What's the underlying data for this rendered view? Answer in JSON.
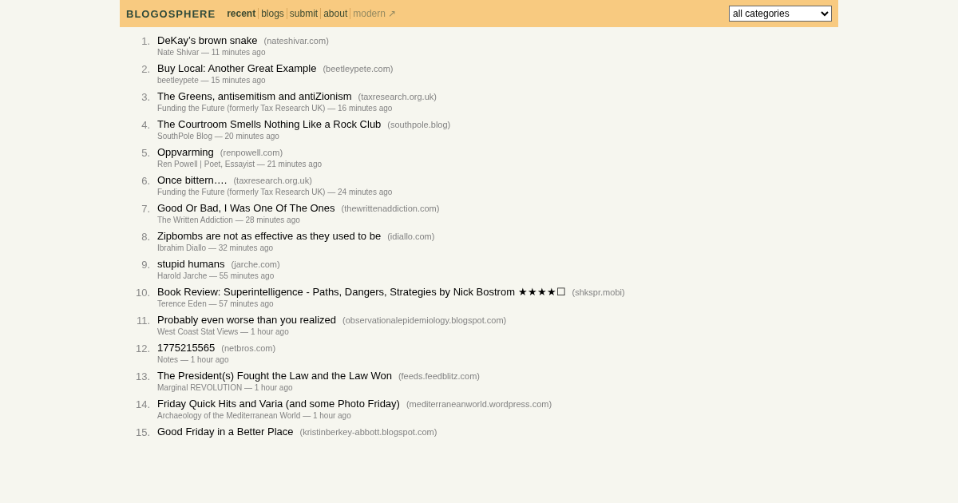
{
  "header": {
    "logo": "BLOGOSPHERE",
    "nav": [
      {
        "label": "recent",
        "selected": true,
        "kind": "internal"
      },
      {
        "label": "blogs",
        "selected": false,
        "kind": "internal"
      },
      {
        "label": "submit",
        "selected": false,
        "kind": "internal"
      },
      {
        "label": "about",
        "selected": false,
        "kind": "internal"
      },
      {
        "label": "modern ↗",
        "selected": false,
        "kind": "external"
      }
    ],
    "category_select": {
      "value": "all categories"
    }
  },
  "posts": [
    {
      "rank": "1.",
      "title": "DeKay’s brown snake",
      "domain": "(nateshivar.com)",
      "meta": "Nate Shivar — 11 minutes ago"
    },
    {
      "rank": "2.",
      "title": "Buy Local: Another Great Example",
      "domain": "(beetleypete.com)",
      "meta": "beetleypete — 15 minutes ago"
    },
    {
      "rank": "3.",
      "title": "The Greens, antisemitism and antiZionism",
      "domain": "(taxresearch.org.uk)",
      "meta": "Funding the Future (formerly Tax Research UK) — 16 minutes ago"
    },
    {
      "rank": "4.",
      "title": "The Courtroom Smells Nothing Like a Rock Club",
      "domain": "(southpole.blog)",
      "meta": "SouthPole Blog — 20 minutes ago"
    },
    {
      "rank": "5.",
      "title": "Oppvarming",
      "domain": "(renpowell.com)",
      "meta": "Ren Powell | Poet, Essayist — 21 minutes ago"
    },
    {
      "rank": "6.",
      "title": "Once bittern….",
      "domain": "(taxresearch.org.uk)",
      "meta": "Funding the Future (formerly Tax Research UK) — 24 minutes ago"
    },
    {
      "rank": "7.",
      "title": "Good Or Bad, I Was One Of The Ones",
      "domain": "(thewrittenaddiction.com)",
      "meta": "The Written Addiction — 28 minutes ago"
    },
    {
      "rank": "8.",
      "title": "Zipbombs are not as effective as they used to be",
      "domain": "(idiallo.com)",
      "meta": "Ibrahim Diallo — 32 minutes ago"
    },
    {
      "rank": "9.",
      "title": "stupid humans",
      "domain": "(jarche.com)",
      "meta": "Harold Jarche — 55 minutes ago"
    },
    {
      "rank": "10.",
      "title": "Book Review: Superintelligence - Paths, Dangers, Strategies by Nick Bostrom ★★★★☐",
      "domain": "(shkspr.mobi)",
      "meta": "Terence Eden — 57 minutes ago"
    },
    {
      "rank": "11.",
      "title": "Probably even worse than you realized",
      "domain": "(observationalepidemiology.blogspot.com)",
      "meta": "West Coast Stat Views — 1 hour ago"
    },
    {
      "rank": "12.",
      "title": "1775215565",
      "domain": "(netbros.com)",
      "meta": "Notes — 1 hour ago"
    },
    {
      "rank": "13.",
      "title": "The President(s) Fought the Law and the Law Won",
      "domain": "(feeds.feedblitz.com)",
      "meta": "Marginal REVOLUTION — 1 hour ago"
    },
    {
      "rank": "14.",
      "title": "Friday Quick Hits and Varia (and some Photo Friday)",
      "domain": "(mediterraneanworld.wordpress.com)",
      "meta": "Archaeology of the Mediterranean World — 1 hour ago"
    },
    {
      "rank": "15.",
      "title": "Good Friday in a Better Place",
      "domain": "(kristinberkey-abbott.blogspot.com)"
    }
  ]
}
